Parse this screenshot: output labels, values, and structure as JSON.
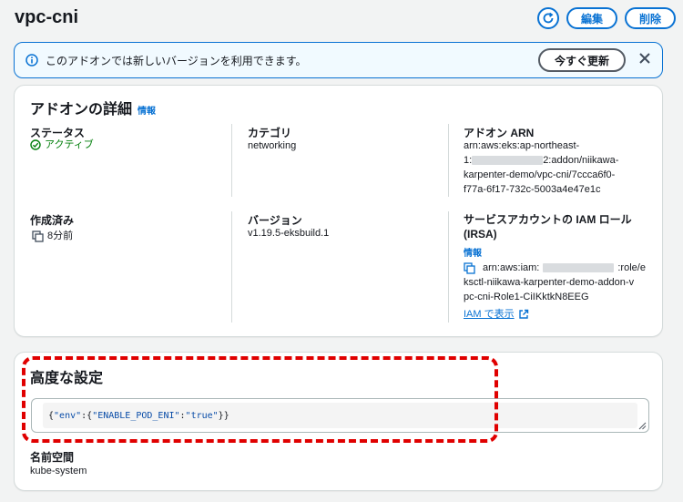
{
  "header": {
    "title": "vpc-cni",
    "refresh_icon": "refresh-icon",
    "edit_label": "編集",
    "delete_label": "削除"
  },
  "banner": {
    "icon": "info-icon",
    "message": "このアドオンでは新しいバージョンを利用できます。",
    "update_label": "今すぐ更新",
    "close_icon": "close-icon"
  },
  "details": {
    "title": "アドオンの詳細",
    "info": "情報",
    "status_label": "ステータス",
    "status_value": "アクティブ",
    "category_label": "カテゴリ",
    "category_value": "networking",
    "arn_label": "アドオン ARN",
    "arn_line1": "arn:aws:eks:ap-northeast-",
    "arn_line2_prefix": "1:",
    "arn_line2_suffix": "2:addon/niikawa-",
    "arn_line3": "karpenter-demo/vpc-cni/7ccca6f0-",
    "arn_line4": "f77a-6f17-732c-5003a4e47e1c",
    "created_label": "作成済み",
    "created_value": "8分前",
    "version_label": "バージョン",
    "version_value": "v1.19.5-eksbuild.1",
    "role_label_line1": "サービスアカウントの IAM ロール",
    "role_label_line2": "(IRSA)",
    "role_info": "情報",
    "role_line1_prefix": "arn:aws:iam:",
    "role_line1_suffix": ":role/e",
    "role_line2": "ksctl-niikawa-karpenter-demo-addon-v",
    "role_line3": "pc-cni-Role1-CiIKktkN8EEG",
    "iam_link": "IAM で表示",
    "copy_icon": "copy-icon",
    "external_icon": "external-link-icon"
  },
  "advanced": {
    "title": "高度な設定",
    "config_open": "{",
    "config_key1": "\"env\"",
    "config_colon1": ":{",
    "config_key2": "\"ENABLE_POD_ENI\"",
    "config_colon2": ":",
    "config_val": "\"true\"",
    "config_close": "}}",
    "namespace_label": "名前空間",
    "namespace_value": "kube-system"
  },
  "colors": {
    "accent": "#0972d3",
    "success": "#037f0c",
    "highlight": "#e00000"
  }
}
